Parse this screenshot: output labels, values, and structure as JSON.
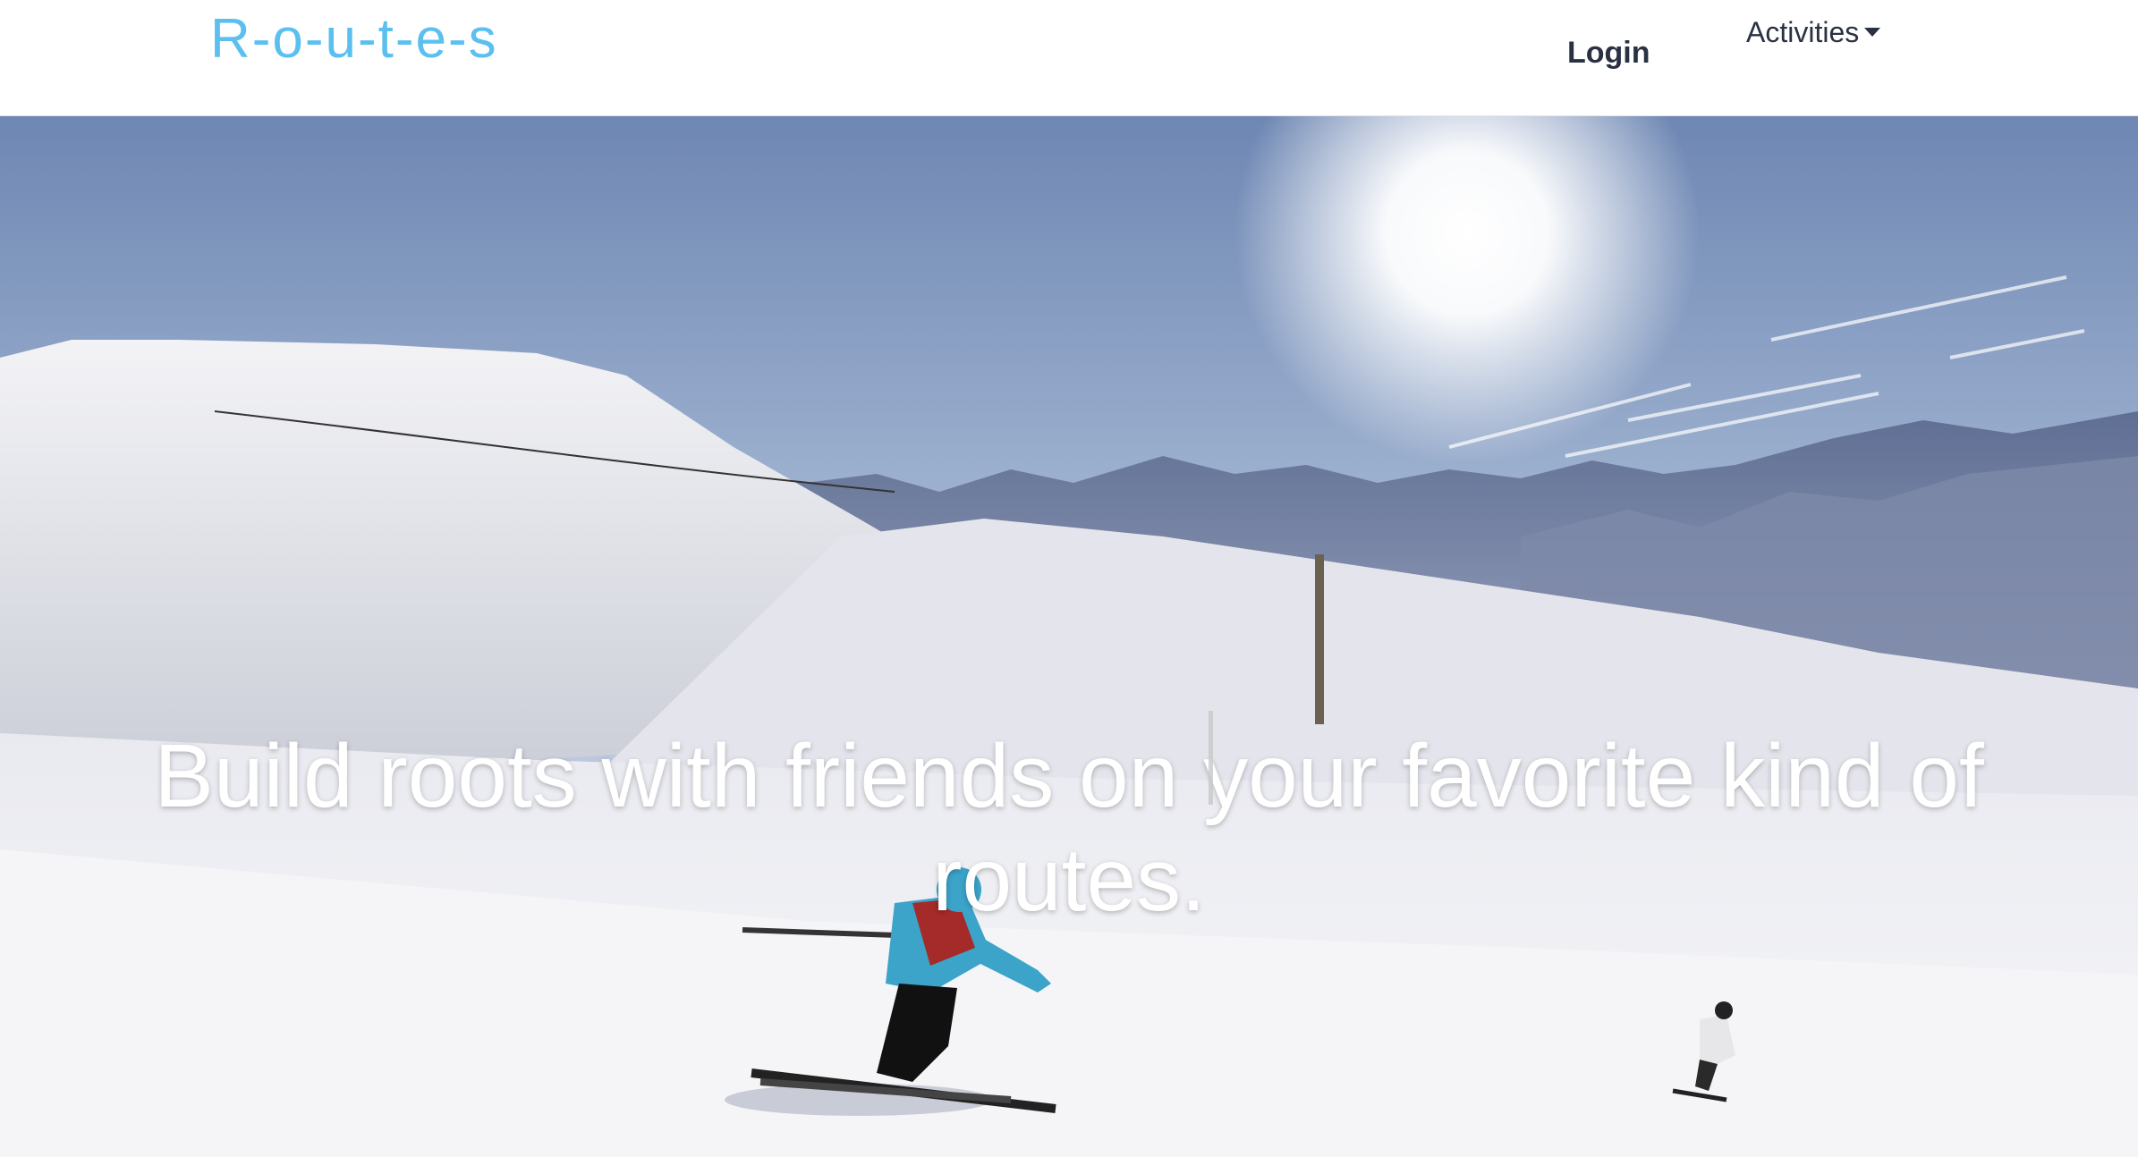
{
  "brand": {
    "name": "R-o-u-t-e-s"
  },
  "nav": {
    "login_label": "Login",
    "activities_label": "Activities"
  },
  "hero": {
    "heading": "Build roots with friends on your favorite kind of routes."
  },
  "colors": {
    "brand": "#5bc0f0",
    "nav_text": "#2a3142",
    "hero_text": "#ffffff"
  }
}
